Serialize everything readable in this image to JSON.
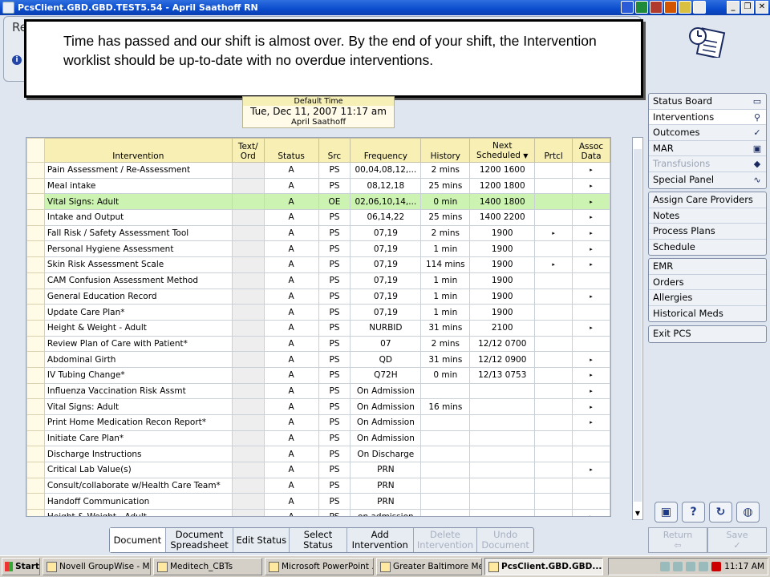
{
  "window": {
    "title": "PcsClient.GBD.GBD.TEST5.54 - April Saathoff RN"
  },
  "header": {
    "partial_title": "Re"
  },
  "overlay": {
    "text": "Time has passed and our shift is almost over. By the end of your shift, the Intervention worklist should be up-to-date with no overdue interventions."
  },
  "default_time": {
    "label": "Default Time",
    "value": "Tue, Dec 11, 2007  11:17 am",
    "user": "April Saathoff"
  },
  "table": {
    "headers": {
      "intervention": "Intervention",
      "text_ord": "Text/ Ord",
      "status": "Status",
      "src": "Src",
      "frequency": "Frequency",
      "history": "History",
      "next_scheduled": "Next Scheduled",
      "prtcl": "Prtcl",
      "assoc_data": "Assoc Data"
    },
    "rows": [
      {
        "name": "Pain Assessment / Re-Assessment",
        "status": "A",
        "src": "PS",
        "freq": "00,04,08,12,...",
        "hist": "2 mins",
        "next": "1200 1600",
        "prtcl": "",
        "assoc": "▸"
      },
      {
        "name": "Meal intake",
        "status": "A",
        "src": "PS",
        "freq": "08,12,18",
        "hist": "25 mins",
        "next": "1200 1800",
        "prtcl": "",
        "assoc": "▸"
      },
      {
        "name": "Vital Signs: Adult",
        "status": "A",
        "src": "OE",
        "freq": "02,06,10,14,...",
        "hist": "0 min",
        "next": "1400 1800",
        "prtcl": "",
        "assoc": "▸",
        "hl": true
      },
      {
        "name": "Intake and Output",
        "status": "A",
        "src": "PS",
        "freq": "06,14,22",
        "hist": "25 mins",
        "next": "1400 2200",
        "prtcl": "",
        "assoc": "▸"
      },
      {
        "name": "Fall Risk / Safety Assessment Tool",
        "status": "A",
        "src": "PS",
        "freq": "07,19",
        "hist": "2 mins",
        "next": "1900",
        "prtcl": "▸",
        "assoc": "▸"
      },
      {
        "name": "Personal Hygiene Assessment",
        "status": "A",
        "src": "PS",
        "freq": "07,19",
        "hist": "1 min",
        "next": "1900",
        "prtcl": "",
        "assoc": "▸"
      },
      {
        "name": "Skin Risk Assessment Scale",
        "status": "A",
        "src": "PS",
        "freq": "07,19",
        "hist": "114 mins",
        "next": "1900",
        "prtcl": "▸",
        "assoc": "▸"
      },
      {
        "name": "CAM Confusion Assessment Method",
        "status": "A",
        "src": "PS",
        "freq": "07,19",
        "hist": "1 min",
        "next": "1900",
        "prtcl": "",
        "assoc": ""
      },
      {
        "name": "General Education Record",
        "status": "A",
        "src": "PS",
        "freq": "07,19",
        "hist": "1 min",
        "next": "1900",
        "prtcl": "",
        "assoc": "▸"
      },
      {
        "name": "Update Care Plan*",
        "status": "A",
        "src": "PS",
        "freq": "07,19",
        "hist": "1 min",
        "next": "1900",
        "prtcl": "",
        "assoc": ""
      },
      {
        "name": "Height & Weight - Adult",
        "status": "A",
        "src": "PS",
        "freq": "NURBID",
        "hist": "31 mins",
        "next": "2100",
        "prtcl": "",
        "assoc": "▸"
      },
      {
        "name": "Review Plan of Care with Patient*",
        "status": "A",
        "src": "PS",
        "freq": "07",
        "hist": "2 mins",
        "next": "12/12 0700",
        "prtcl": "",
        "assoc": ""
      },
      {
        "name": "Abdominal Girth",
        "status": "A",
        "src": "PS",
        "freq": "QD",
        "hist": "31 mins",
        "next": "12/12 0900",
        "prtcl": "",
        "assoc": "▸"
      },
      {
        "name": "IV Tubing Change*",
        "status": "A",
        "src": "PS",
        "freq": "Q72H",
        "hist": "0 min",
        "next": "12/13 0753",
        "prtcl": "",
        "assoc": "▸"
      },
      {
        "name": "Influenza Vaccination Risk Assmt",
        "status": "A",
        "src": "PS",
        "freq": "On Admission",
        "hist": "",
        "next": "",
        "prtcl": "",
        "assoc": "▸"
      },
      {
        "name": "Vital Signs: Adult",
        "status": "A",
        "src": "PS",
        "freq": "On Admission",
        "hist": "16 mins",
        "next": "",
        "prtcl": "",
        "assoc": "▸"
      },
      {
        "name": "Print Home Medication Recon Report*",
        "status": "A",
        "src": "PS",
        "freq": "On Admission",
        "hist": "",
        "next": "",
        "prtcl": "",
        "assoc": "▸"
      },
      {
        "name": "Initiate Care Plan*",
        "status": "A",
        "src": "PS",
        "freq": "On Admission",
        "hist": "",
        "next": "",
        "prtcl": "",
        "assoc": ""
      },
      {
        "name": "Discharge Instructions",
        "status": "A",
        "src": "PS",
        "freq": "On Discharge",
        "hist": "",
        "next": "",
        "prtcl": "",
        "assoc": ""
      },
      {
        "name": "Critical Lab Value(s)",
        "status": "A",
        "src": "PS",
        "freq": "PRN",
        "hist": "",
        "next": "",
        "prtcl": "",
        "assoc": "▸"
      },
      {
        "name": "Consult/collaborate w/Health Care Team*",
        "status": "A",
        "src": "PS",
        "freq": "PRN",
        "hist": "",
        "next": "",
        "prtcl": "",
        "assoc": ""
      },
      {
        "name": "Handoff Communication",
        "status": "A",
        "src": "PS",
        "freq": "PRN",
        "hist": "",
        "next": "",
        "prtcl": "",
        "assoc": ""
      },
      {
        "name": "Height & Weight - Adult",
        "status": "A",
        "src": "PS",
        "freq": "on admission",
        "hist": "",
        "next": "",
        "prtcl": "",
        "assoc": "▸"
      }
    ]
  },
  "nav": {
    "group1": [
      {
        "label": "Status Board",
        "icon": "book-icon",
        "glyph": "▭"
      },
      {
        "label": "Interventions",
        "icon": "interventions-icon",
        "glyph": "⚲",
        "active": true
      },
      {
        "label": "Outcomes",
        "icon": "checkmark-icon",
        "glyph": "✓"
      },
      {
        "label": "MAR",
        "icon": "mar-icon",
        "glyph": "▣"
      },
      {
        "label": "Transfusions",
        "icon": "transfusion-icon",
        "glyph": "◆",
        "disabled": true
      },
      {
        "label": "Special Panel",
        "icon": "heartbeat-icon",
        "glyph": "∿"
      }
    ],
    "group2": [
      "Assign Care Providers",
      "Notes",
      "Process Plans",
      "Schedule"
    ],
    "group3": [
      "EMR",
      "Orders",
      "Allergies",
      "Historical Meds"
    ],
    "group4": [
      "Exit PCS"
    ]
  },
  "icon_buttons": [
    {
      "name": "lock-icon",
      "glyph": "▣"
    },
    {
      "name": "help-icon",
      "glyph": "?"
    },
    {
      "name": "refresh-icon",
      "glyph": "↻"
    },
    {
      "name": "web-icon",
      "glyph": "◍"
    }
  ],
  "bottom_bar": [
    {
      "label": "Document",
      "active": true
    },
    {
      "label": "Document Spreadsheet"
    },
    {
      "label": "Edit Status"
    },
    {
      "label": "Select Status"
    },
    {
      "label": "Add Intervention"
    },
    {
      "label": "Delete Intervention",
      "disabled": true
    },
    {
      "label": "Undo Document",
      "disabled": true
    }
  ],
  "return_save": [
    {
      "label": "Return",
      "glyph": "⇦"
    },
    {
      "label": "Save",
      "glyph": "✓"
    }
  ],
  "taskbar": {
    "start": "Start",
    "tasks": [
      {
        "label": "Novell GroupWise - M..."
      },
      {
        "label": "Meditech_CBTs"
      },
      {
        "label": "Microsoft PowerPoint ..."
      },
      {
        "label": "Greater Baltimore Me..."
      },
      {
        "label": "PcsClient.GBD.GBD....",
        "active": true
      }
    ],
    "clock": "11:17 AM"
  },
  "colors": {
    "titlebar": "#0a4ccc",
    "highlight_row": "#cdf3b3",
    "header_yellow": "#f7efb4"
  }
}
